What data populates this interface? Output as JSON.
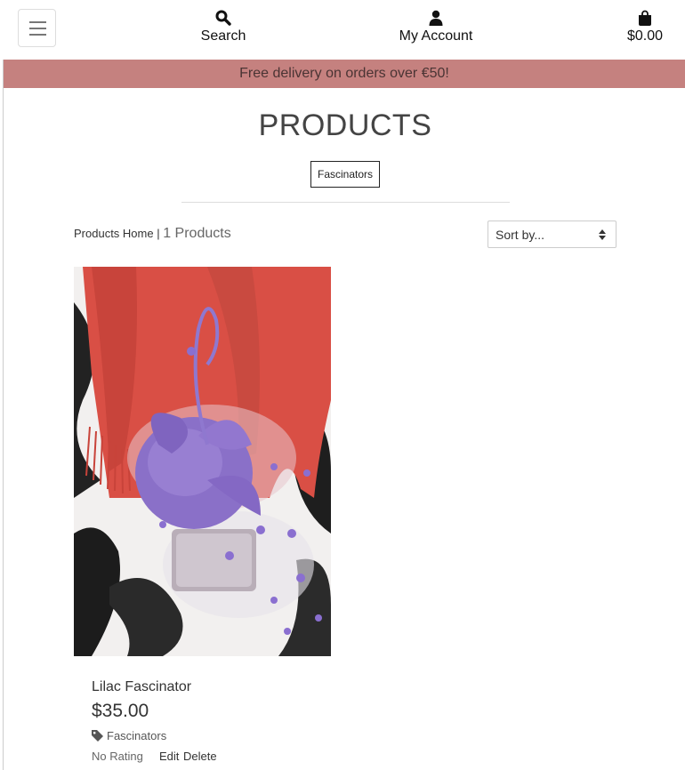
{
  "header": {
    "search_label": "Search",
    "account_label": "My Account",
    "bag_total": "$0.00"
  },
  "banner": {
    "text": "Free delivery on orders over €50!"
  },
  "page": {
    "title": "PRODUCTS",
    "category_button": "Fascinators",
    "breadcrumb_link": "Products Home",
    "breadcrumb_sep": " | ",
    "product_count": "1 Products",
    "sort_selected": "Sort by..."
  },
  "products": [
    {
      "name": "Lilac Fascinator",
      "price": "$35.00",
      "category": "Fascinators",
      "rating": "No Rating",
      "edit_label": "Edit",
      "delete_label": "Delete"
    }
  ],
  "colors": {
    "banner_bg": "#c5817f",
    "hat": "#8a70c8",
    "scarf": "#d94f45"
  },
  "icons": {
    "menu": "hamburger-icon",
    "search": "search-icon",
    "account": "user-icon",
    "bag": "shopping-bag-icon",
    "tag": "tag-icon",
    "sort": "sort-arrows-icon"
  }
}
